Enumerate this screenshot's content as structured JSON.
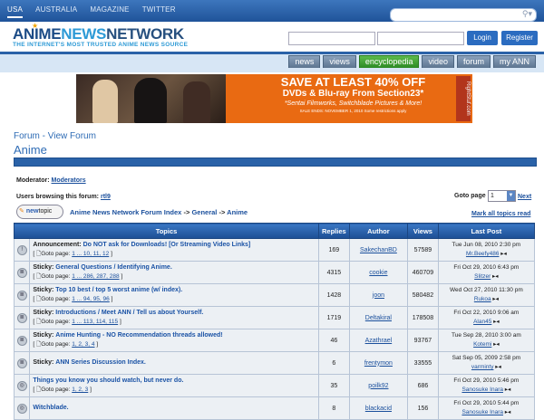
{
  "topnav": [
    "USA",
    "AUSTRALIA",
    "MAGAZINE",
    "TWITTER"
  ],
  "logo": {
    "anime": "ANIME",
    "news": "NEWS",
    "network": "NETWORK",
    "tagline": "THE INTERNET'S MOST TRUSTED ANIME NEWS SOURCE"
  },
  "auth": {
    "login": "Login",
    "register": "Register"
  },
  "tabs": [
    "news",
    "views",
    "encyclopedia",
    "video",
    "forum",
    "my ANN"
  ],
  "banner": {
    "line1": "SAVE AT LEAST 40% OFF",
    "line2": "DVDs & Blu-ray From Section23*",
    "line3": "*Sentai Filmworks, Switchblade Pictures & More!",
    "line4": "SALE ENDS: NOVEMBER 1, 2010          Some restrictions apply",
    "logo": "RightStuf.com"
  },
  "page": {
    "crumb_title": "Forum - View Forum",
    "forum_title": "Anime"
  },
  "info": {
    "moderator_label": "Moderator:",
    "moderator_value": "Moderators",
    "browsing_label": "Users browsing this forum:",
    "browsing_value": "rtl9",
    "goto_label": "Goto page",
    "goto_value": "1",
    "next": "Next",
    "new_topic_prefix": "new",
    "new_topic": "topic",
    "mark_all": "Mark all topics read"
  },
  "breadcrumb": {
    "index": "Anime News Network Forum Index",
    "sep": "->",
    "general": "General",
    "anime": "Anime"
  },
  "columns": {
    "topics": "Topics",
    "replies": "Replies",
    "author": "Author",
    "views": "Views",
    "last": "Last Post"
  },
  "goto_prefix": "[ ",
  "goto_label": "Goto page:",
  "rows": [
    {
      "icon": "!",
      "prefix": "Announcement:",
      "title": "Do NOT ask for Downloads! [Or Streaming Video Links]",
      "pages": "1 ... 10, 11, 12",
      "replies": "169",
      "author": "SakechanBD",
      "views": "57589",
      "date": "Tue Jun 08, 2010 2:30 pm",
      "last_user": "Mr.Beefy486"
    },
    {
      "icon": "≣",
      "prefix": "Sticky:",
      "title": "General Questions / Identifying Anime.",
      "pages": "1 ... 286, 287, 288",
      "replies": "4315",
      "author": "cookie",
      "views": "460709",
      "date": "Fri Oct 29, 2010 6:43 pm",
      "last_user": "Slitzer"
    },
    {
      "icon": "≣",
      "prefix": "Sticky:",
      "title": "Top 10 best / top 5 worst anime (w/ index).",
      "pages": "1 ... 94, 95, 96",
      "replies": "1428",
      "author": "joon",
      "views": "580482",
      "date": "Wed Oct 27, 2010 11:30 pm",
      "last_user": "Rukoa"
    },
    {
      "icon": "≣",
      "prefix": "Sticky:",
      "title": "Introductions / Meet ANN / Tell us about Yourself.",
      "pages": "1 ... 113, 114, 115",
      "replies": "1719",
      "author": "Deltakiral",
      "views": "178508",
      "date": "Fri Oct 22, 2010 9:06 am",
      "last_user": "Alan45"
    },
    {
      "icon": "≣",
      "prefix": "Sticky:",
      "title": "Anime Hunting - NO Recommendation threads allowed!",
      "pages": "1, 2, 3, 4",
      "replies": "46",
      "author": "Azathrael",
      "views": "93767",
      "date": "Tue Sep 28, 2010 3:00 am",
      "last_user": "Kotemi"
    },
    {
      "icon": "≣",
      "prefix": "Sticky:",
      "title": "ANN Series Discussion Index.",
      "pages": "",
      "replies": "6",
      "author": "frentymon",
      "views": "33555",
      "date": "Sat Sep 05, 2009 2:58 pm",
      "last_user": "varminty"
    },
    {
      "icon": "◎",
      "prefix": "",
      "title": "Things you know you should watch, but never do.",
      "pages": "1, 2, 3",
      "replies": "35",
      "author": "poilk92",
      "views": "686",
      "date": "Fri Oct 29, 2010 5:46 pm",
      "last_user": "Sanosuke Inara"
    },
    {
      "icon": "◎",
      "prefix": "",
      "title": "Witchblade.",
      "pages": "",
      "replies": "8",
      "author": "blackacid",
      "views": "156",
      "date": "Fri Oct 29, 2010 5:44 pm",
      "last_user": "Sanosuke Inara"
    }
  ]
}
